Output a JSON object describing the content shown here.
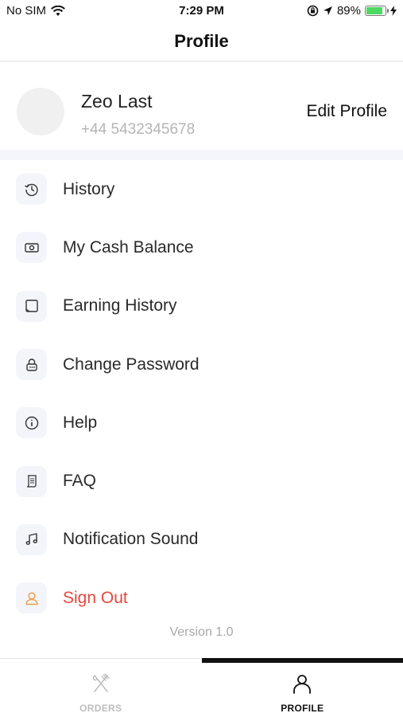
{
  "status_bar": {
    "carrier": "No SIM",
    "time": "7:29 PM",
    "battery_percent": "89%",
    "battery_level": 0.89,
    "battery_color": "#4cd964"
  },
  "header": {
    "title": "Profile"
  },
  "profile": {
    "name": "Zeo Last",
    "phone": "+44 5432345678",
    "edit_label": "Edit Profile"
  },
  "menu": {
    "items": [
      {
        "label": "History",
        "icon": "history-icon"
      },
      {
        "label": "My Cash Balance",
        "icon": "cash-icon"
      },
      {
        "label": "Earning History",
        "icon": "earning-history-icon"
      },
      {
        "label": "Change Password",
        "icon": "lock-icon"
      },
      {
        "label": "Help",
        "icon": "info-icon"
      },
      {
        "label": "FAQ",
        "icon": "scroll-icon"
      },
      {
        "label": "Notification Sound",
        "icon": "music-note-icon"
      },
      {
        "label": "Sign Out",
        "icon": "user-icon",
        "color": "#e8473f"
      }
    ]
  },
  "version": "Version 1.0",
  "tabs": [
    {
      "label": "ORDERS",
      "icon": "fork-knife-icon",
      "active": false
    },
    {
      "label": "PROFILE",
      "icon": "person-icon",
      "active": true
    }
  ],
  "colors": {
    "accent_danger": "#e8473f",
    "sign_out_icon": "#f0a04b",
    "icon_tile_bg": "#f3f5fb"
  }
}
